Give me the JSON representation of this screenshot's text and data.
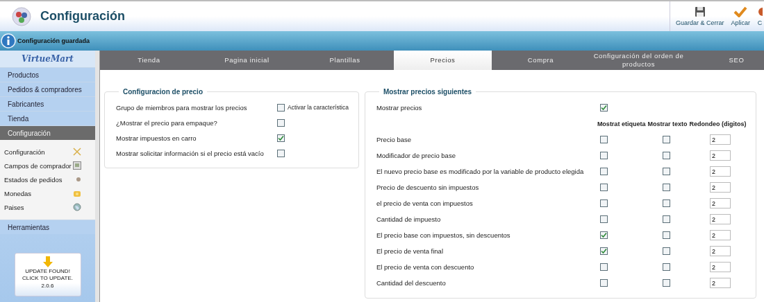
{
  "header": {
    "title": "Configuración",
    "toolbar": [
      {
        "kind": "save",
        "label": "Guardar & Cerrar"
      },
      {
        "kind": "apply",
        "label": "Aplicar"
      },
      {
        "kind": "cut",
        "label": "C"
      }
    ]
  },
  "message": "Configuración guardada",
  "sidebar": {
    "logo": "VirtueMart",
    "menu": [
      {
        "label": "Productos",
        "selected": false
      },
      {
        "label": "Pedidos & compradores",
        "selected": false
      },
      {
        "label": "Fabricantes",
        "selected": false
      },
      {
        "label": "Tienda",
        "selected": false
      },
      {
        "label": "Configuración",
        "selected": true
      }
    ],
    "submenu": [
      {
        "label": "Configuración",
        "kind": "tools"
      },
      {
        "label": "Campos de comprador",
        "kind": "form"
      },
      {
        "label": "Estados de pedidos",
        "kind": "dot"
      },
      {
        "label": "Monedas",
        "kind": "coins"
      },
      {
        "label": "Paises",
        "kind": "globe"
      }
    ],
    "tools": {
      "label": "Herramientas",
      "selected": false
    },
    "update": {
      "message": "UPDATE FOUND! CLICK TO UPDATE.",
      "version": "2.0.6"
    }
  },
  "tabs": [
    {
      "label": "Tienda",
      "selected": false
    },
    {
      "label": "Pagina inicial",
      "selected": false
    },
    {
      "label": "Plantillas",
      "selected": false
    },
    {
      "label": "Precios",
      "selected": true
    },
    {
      "label": "Compra",
      "selected": false
    },
    {
      "label": "Configuración del orden de productos",
      "selected": false
    },
    {
      "label": "SEO",
      "selected": false
    }
  ],
  "price_config": {
    "title": "Configuracion de precio",
    "rows": [
      {
        "label": "Grupo de miembros para mostrar los precios",
        "checked": false,
        "note": "Activar la característica"
      },
      {
        "label": "¿Mostrar el precio para empaque?",
        "checked": false
      },
      {
        "label": "Mostrar impuestos en carro",
        "checked": true
      },
      {
        "label": "Mostrar solicitar información si el precio está vacío",
        "checked": false
      }
    ]
  },
  "show_prices": {
    "title": "Mostrar precios siguientes",
    "show": {
      "label": "Mostrar precios",
      "checked": true
    },
    "columns": [
      "Mostrat etiqueta",
      "Mostrar texto",
      "Redondeo (digitos)"
    ],
    "rows": [
      {
        "label": "Precio base",
        "show_label": false,
        "show_text": false,
        "rounding": "2"
      },
      {
        "label": "Modificador de precio base",
        "show_label": false,
        "show_text": false,
        "rounding": "2"
      },
      {
        "label": "El nuevo precio base es modificado por la variable de producto elegida",
        "show_label": false,
        "show_text": false,
        "rounding": "2"
      },
      {
        "label": "Precio de descuento sin impuestos",
        "show_label": false,
        "show_text": false,
        "rounding": "2"
      },
      {
        "label": "el precio de venta con impuestos",
        "show_label": false,
        "show_text": false,
        "rounding": "2"
      },
      {
        "label": "Cantidad de impuesto",
        "show_label": false,
        "show_text": false,
        "rounding": "2"
      },
      {
        "label": "El precio base con impuestos, sin descuentos",
        "show_label": true,
        "show_text": false,
        "rounding": "2"
      },
      {
        "label": "El precio de venta final",
        "show_label": true,
        "show_text": false,
        "rounding": "2"
      },
      {
        "label": "El precio de venta con descuento",
        "show_label": false,
        "show_text": false,
        "rounding": "2"
      },
      {
        "label": "Cantidad del descuento",
        "show_label": false,
        "show_text": false,
        "rounding": "2"
      }
    ]
  }
}
